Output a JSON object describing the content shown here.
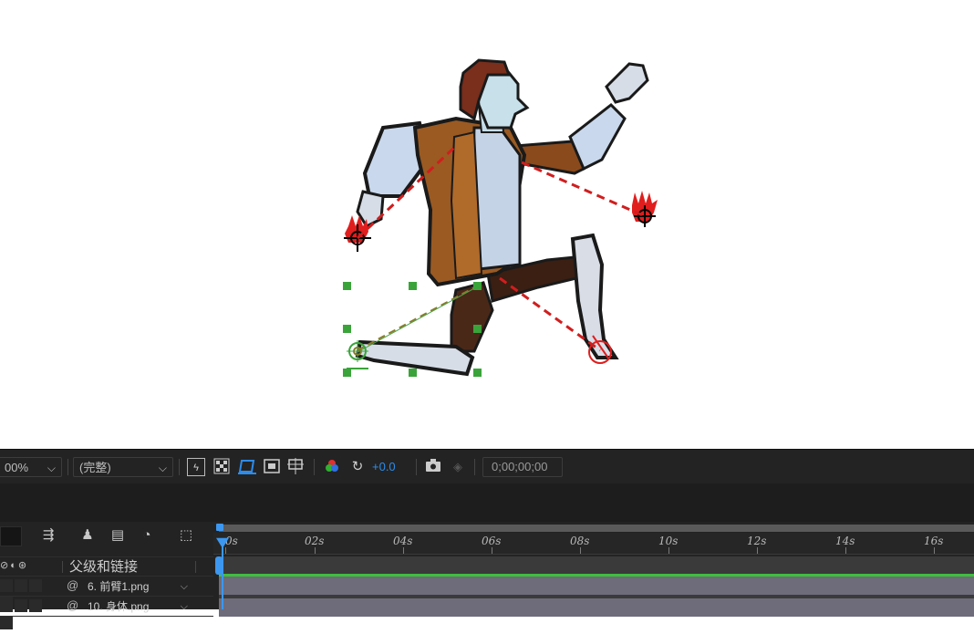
{
  "toolbar": {
    "zoom_value": "00%",
    "resolution_value": "(完整)",
    "exposure_value": "+0.0",
    "timecode": "0;00;00;00",
    "accent_color": "#2d8ceb"
  },
  "timeline": {
    "ruler_labels": [
      "0s",
      "02s",
      "04s",
      "06s",
      "08s",
      "10s",
      "12s",
      "14s",
      "16s"
    ],
    "column_header_parent": "父级和链接",
    "layers": [
      {
        "parent": "6. 前臂1.png"
      },
      {
        "parent": "10. 身体.png"
      }
    ],
    "track_color": "#6e6b7a",
    "work_area_color": "#3fbf3f"
  },
  "icons": {
    "toolbar": [
      "fast-preview-icon",
      "transparency-grid-icon",
      "mask-visibility-icon",
      "region-of-interest-icon",
      "guides-icon",
      "color-channels-icon",
      "reset-exposure-icon",
      "snapshot-icon",
      "show-snapshot-icon"
    ],
    "timeline_tools": [
      "composition-flowchart-icon",
      "shy-layers-icon",
      "frame-blending-icon",
      "motion-blur-icon",
      "graph-editor-icon"
    ]
  }
}
